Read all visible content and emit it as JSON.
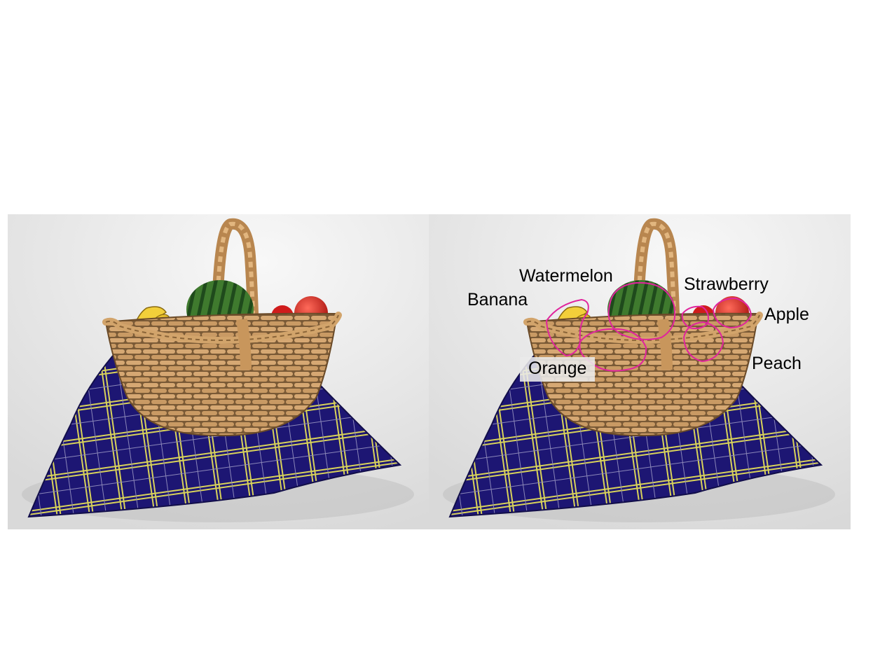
{
  "labels": {
    "watermelon": "Watermelon",
    "banana": "Banana",
    "strawberry": "Strawberry",
    "apple": "Apple",
    "peach": "Peach",
    "orange": "Orange"
  },
  "colors": {
    "outline": "#e0259d",
    "tablecloth": "#1d1673",
    "plaid_line": "#d8d25a",
    "wicker": "#c89a62",
    "background": "#ffffff"
  }
}
